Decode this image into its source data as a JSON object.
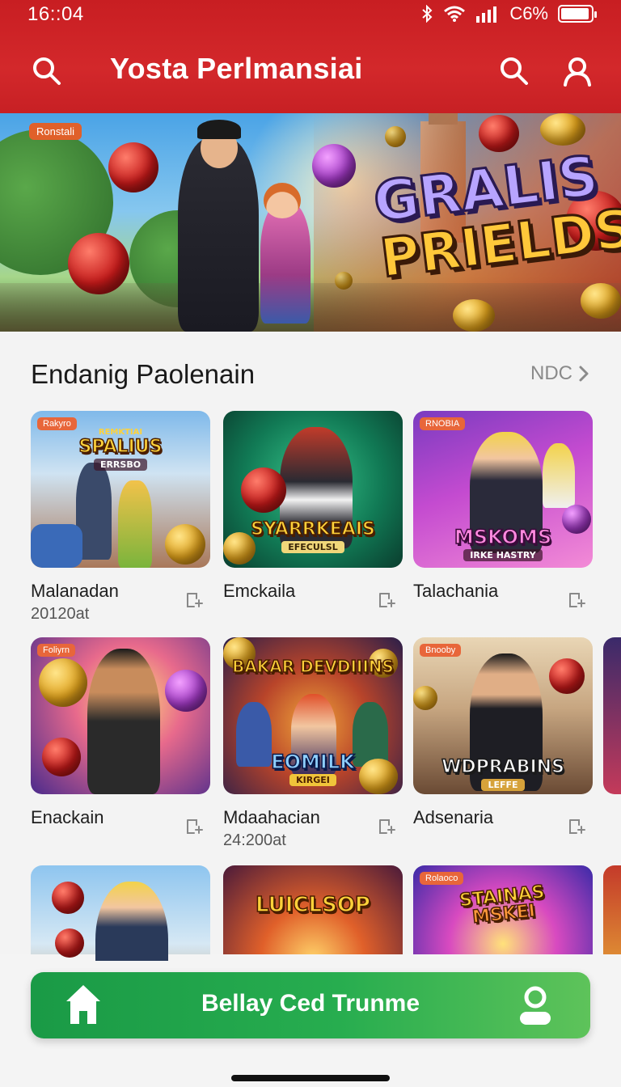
{
  "status_bar": {
    "time": "16::04",
    "battery_text": "C6%"
  },
  "header": {
    "title": "Yosta Perlmansiai"
  },
  "hero": {
    "badge": "Ronstali",
    "title_line1": "GRALIS",
    "title_line2": "PRIELDS"
  },
  "section": {
    "title": "Endanig Paolenain",
    "more_label": "NDC"
  },
  "games": [
    {
      "badge": "Rakyro",
      "logo": "SPALIUS",
      "logo_top": "REMKTIAI",
      "logo_sub": "ERRSBO",
      "name": "Malanadan",
      "sub": "20120at"
    },
    {
      "badge": "",
      "logo": "SYARRKEAIS",
      "logo_top": "",
      "logo_sub": "EFECULSL",
      "name": "Emckaila",
      "sub": ""
    },
    {
      "badge": "RNOBIA",
      "logo": "MSKOMS",
      "logo_top": "",
      "logo_sub": "IRKE HASTRY",
      "name": "Talachania",
      "sub": ""
    },
    {
      "badge": "Foliyrn",
      "logo": "",
      "logo_top": "",
      "logo_sub": "",
      "name": "Enackain",
      "sub": ""
    },
    {
      "badge": "",
      "logo": "EOMILK",
      "logo_top": "BAKAR DEVDIIINS",
      "logo_sub": "KIRGEI",
      "name": "Mdaahacian",
      "sub": "24:200at"
    },
    {
      "badge": "Bnooby",
      "logo": "WDPRABINS",
      "logo_top": "",
      "logo_sub": "LEFFE",
      "name": "Adsenaria",
      "sub": ""
    },
    {
      "badge": "",
      "logo": "",
      "logo_top": "",
      "logo_sub": "",
      "name": "",
      "sub": ""
    },
    {
      "badge": "",
      "logo": "LUICLSOP",
      "logo_top": "",
      "logo_sub": "",
      "name": "",
      "sub": ""
    },
    {
      "badge": "Rolaoco",
      "logo": "MSKEI",
      "logo_top": "STAINAS",
      "logo_sub": "",
      "name": "",
      "sub": ""
    }
  ],
  "bottom_cta": {
    "label": "Bellay Ced Trunme"
  },
  "colors": {
    "header_red": "#c81e22",
    "cta_green": "#1a9a46",
    "badge_orange": "#e8663a"
  }
}
